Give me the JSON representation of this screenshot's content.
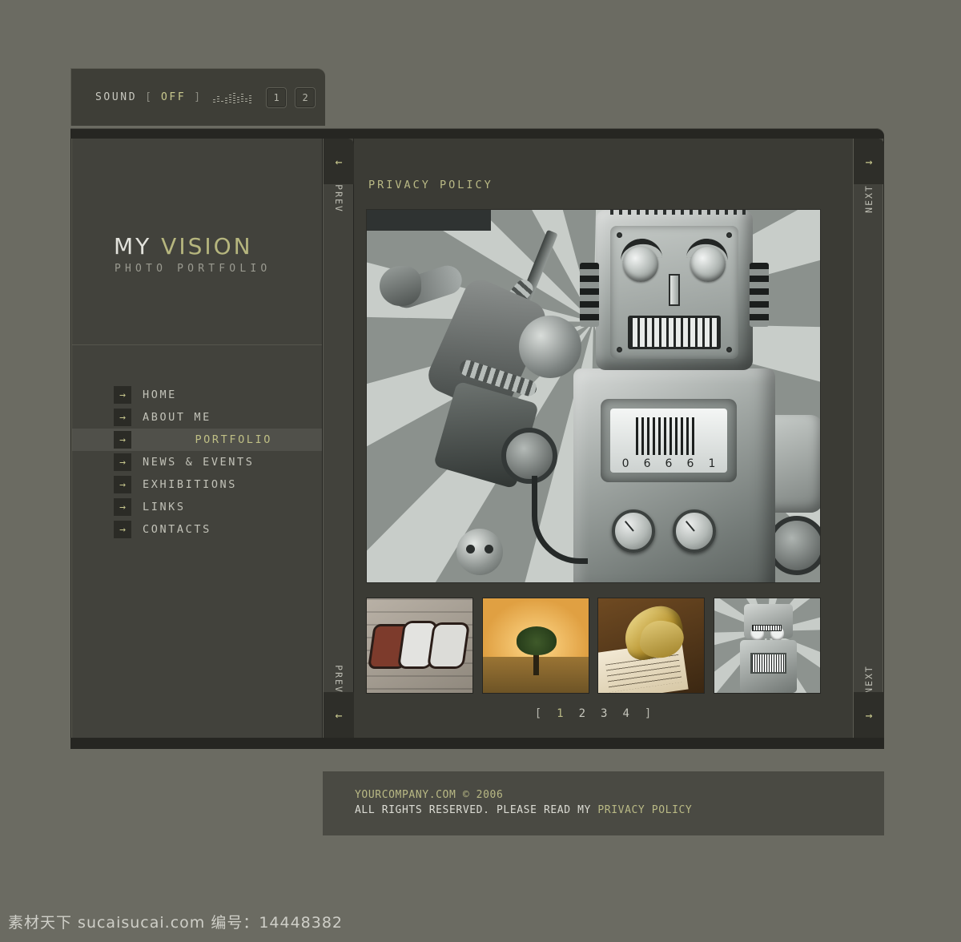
{
  "sound": {
    "label": "SOUND",
    "bracket_open": "[",
    "state": "OFF",
    "bracket_close": "]",
    "equalizer_icon": "equalizer-dots",
    "buttons": [
      "1",
      "2"
    ]
  },
  "brand": {
    "word1": "MY",
    "word2": "VISION",
    "subtitle": "PHOTO PORTFOLIO"
  },
  "nav": {
    "arrow_icon": "arrow-right-icon",
    "items": [
      {
        "label": "HOME",
        "active": false
      },
      {
        "label": "ABOUT ME",
        "active": false
      },
      {
        "label": "PORTFOLIO",
        "active": true
      },
      {
        "label": "NEWS & EVENTS",
        "active": false
      },
      {
        "label": "EXHIBITIONS",
        "active": false
      },
      {
        "label": "LINKS",
        "active": false
      },
      {
        "label": "CONTACTS",
        "active": false
      }
    ]
  },
  "rails": {
    "prev": {
      "word": "PREV",
      "top_icon": "arrow-left-icon",
      "bottom_icon": "arrow-left-icon",
      "top_glyph": "←",
      "bottom_glyph": "←"
    },
    "next": {
      "word": "NEXT",
      "top_icon": "arrow-right-icon",
      "bottom_icon": "arrow-right-icon",
      "top_glyph": "→",
      "bottom_glyph": "→"
    }
  },
  "content": {
    "page_title": "PRIVACY POLICY",
    "hero": {
      "name": "vintage-tin-robot-photo",
      "barcode_digits": [
        "0",
        "6",
        "6",
        "6",
        "1"
      ]
    },
    "thumbnails": [
      {
        "name": "thumbnail-graffiti-wall"
      },
      {
        "name": "thumbnail-lone-tree-sunset"
      },
      {
        "name": "thumbnail-golden-butterfly-sheet-music"
      },
      {
        "name": "thumbnail-tin-robot"
      }
    ],
    "pager": {
      "open": "[",
      "close": "]",
      "pages": [
        "1",
        "2",
        "3",
        "4"
      ],
      "current": "1"
    }
  },
  "footer": {
    "company": "YOURCOMPANY.COM © 2006",
    "rights": "ALL RIGHTS RESERVED. PLEASE READ MY ",
    "policy_link": "PRIVACY POLICY"
  },
  "watermark": {
    "text": "素材天下 sucaisucai.com 编号：14448382"
  },
  "colors": {
    "page_background": "#6b6b62",
    "panel": "#42423c",
    "content_panel": "#3b3b35",
    "dark_chrome": "#262622",
    "accent_olive": "#b9b985",
    "text_light": "#c2c2b8"
  }
}
